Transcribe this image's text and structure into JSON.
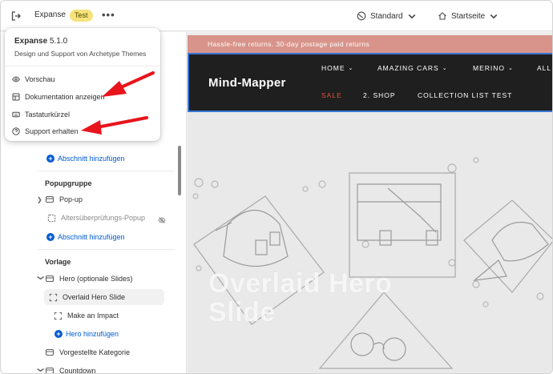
{
  "topbar": {
    "theme_name": "Expanse",
    "badge": "Test",
    "more_label": "•••",
    "view_select": "Standard",
    "page_select": "Startseite"
  },
  "popover": {
    "app_name": "Expanse",
    "version": "5.1.0",
    "subtitle": "Design und Support von Archetype Themes",
    "items": [
      {
        "label": "Vorschau",
        "icon": "eye-icon"
      },
      {
        "label": "Dokumentation anzeigen",
        "icon": "document-icon"
      },
      {
        "label": "Tastaturkürzel",
        "icon": "keyboard-icon"
      },
      {
        "label": "Support erhalten",
        "icon": "help-circle-icon"
      }
    ]
  },
  "sidebar": {
    "add_section_1": "Abschnitt hinzufügen",
    "popup_group": {
      "heading": "Popupgruppe",
      "popup": "Pop-up",
      "age_check": "Altersüberprüfungs-Popup",
      "add_section": "Abschnitt hinzufügen"
    },
    "template": {
      "heading": "Vorlage",
      "hero": "Hero (optionale Slides)",
      "slide_1": "Overlaid Hero Slide",
      "slide_2": "Make an Impact",
      "add_hero": "Hero hinzufügen",
      "featured_collection": "Vorgestellte Kategorie",
      "countdown": "Countdown"
    }
  },
  "preview": {
    "announcement": "Hassle-free returns. 30-day postage paid returns",
    "brand": "Mind-Mapper",
    "nav_row1": [
      "HOME",
      "AMAZING CARS",
      "MERINO",
      "ALL"
    ],
    "nav_row2": [
      "SALE",
      "2. SHOP",
      "COLLECTION LIST TEST"
    ],
    "hero_title": "Overlaid Hero Slide"
  },
  "colors": {
    "announcement_bg": "#d8948a",
    "header_bg": "#1f1f1f",
    "header_outline": "#3a76d6",
    "sale_red": "#e0503c",
    "badge_bg": "#f6e27a",
    "link_blue": "#005bd3",
    "arrow_red": "#e8141c"
  }
}
